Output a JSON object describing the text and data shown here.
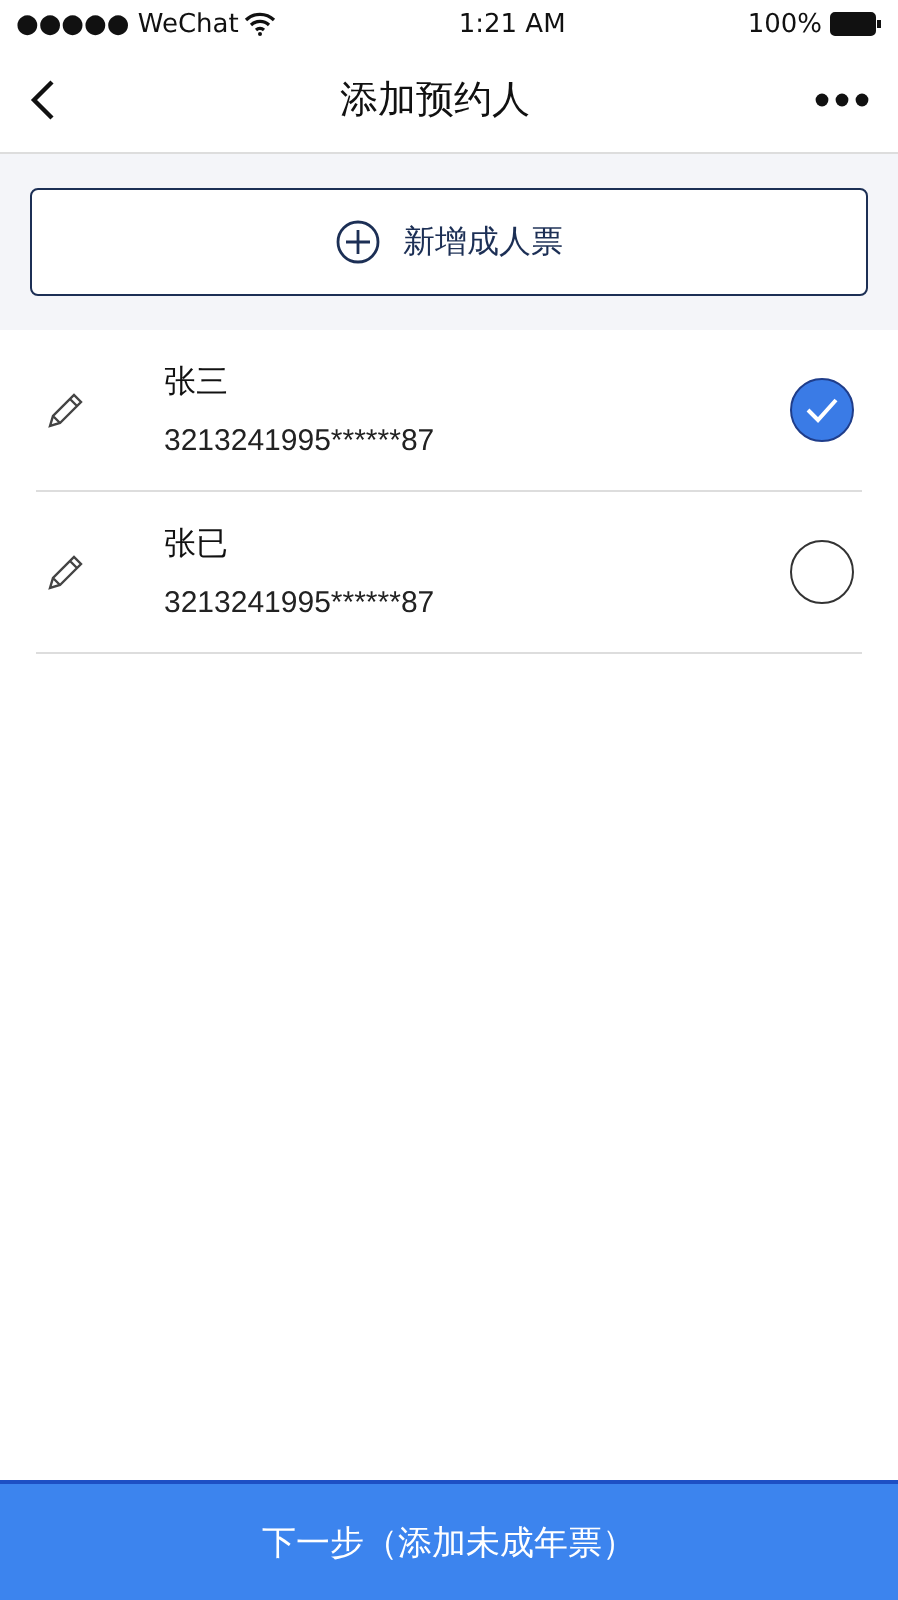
{
  "status_bar": {
    "carrier": "●●●●● WeChat",
    "time": "1:21 AM",
    "battery": "100%"
  },
  "nav": {
    "title": "添加预约人"
  },
  "add_button": {
    "label": "新增成人票"
  },
  "contacts": [
    {
      "name": "张三",
      "id_number": "3213241995******87",
      "selected": true
    },
    {
      "name": "张已",
      "id_number": "3213241995******87",
      "selected": false
    }
  ],
  "next_button": {
    "label": "下一步（添加未成年票）"
  }
}
